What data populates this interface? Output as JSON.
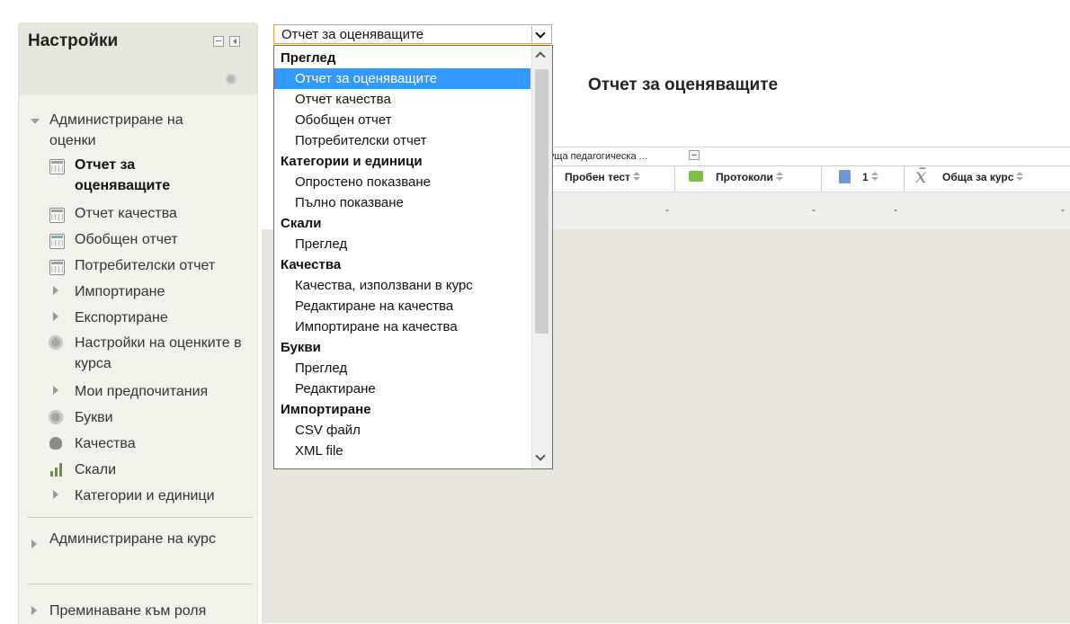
{
  "sidebar": {
    "title": "Настройки",
    "tree": {
      "grade_admin": "Администриране на оценки",
      "items": [
        {
          "label": "Отчет за оценяващите",
          "icon": "report-icon",
          "current": true
        },
        {
          "label": "Отчет качества",
          "icon": "report-icon"
        },
        {
          "label": "Обобщен отчет",
          "icon": "report-icon"
        },
        {
          "label": "Потребителски отчет",
          "icon": "report-icon"
        },
        {
          "label": "Импортиране",
          "icon": "expand-arrow-icon"
        },
        {
          "label": "Експортиране",
          "icon": "expand-arrow-icon"
        },
        {
          "label": "Настройки на оценките в курса",
          "icon": "gear-icon"
        },
        {
          "label": "Мои предпочитания",
          "icon": "expand-arrow-icon"
        },
        {
          "label": "Букви",
          "icon": "gear-icon"
        },
        {
          "label": "Качества",
          "icon": "outcomes-icon"
        },
        {
          "label": "Скали",
          "icon": "scales-icon"
        },
        {
          "label": "Категории и единици",
          "icon": "expand-arrow-icon"
        }
      ],
      "course_admin": "Администриране на курс",
      "switch_role": "Преминаване към роля"
    }
  },
  "report_select": {
    "value": "Отчет за оценяващите",
    "options": [
      {
        "type": "group",
        "label": "Преглед"
      },
      {
        "type": "item",
        "label": "Отчет за оценяващите",
        "selected": true
      },
      {
        "type": "item",
        "label": "Отчет качества"
      },
      {
        "type": "item",
        "label": "Обобщен отчет"
      },
      {
        "type": "item",
        "label": "Потребителски отчет"
      },
      {
        "type": "group",
        "label": "Категории и единици"
      },
      {
        "type": "item",
        "label": "Опростено показване"
      },
      {
        "type": "item",
        "label": "Пълно показване"
      },
      {
        "type": "group",
        "label": "Скали"
      },
      {
        "type": "item",
        "label": "Преглед"
      },
      {
        "type": "group",
        "label": "Качества"
      },
      {
        "type": "item",
        "label": "Качества, използвани в курс"
      },
      {
        "type": "item",
        "label": "Редактиране на качества"
      },
      {
        "type": "item",
        "label": "Импортиране на качества"
      },
      {
        "type": "group",
        "label": "Букви"
      },
      {
        "type": "item",
        "label": "Преглед"
      },
      {
        "type": "item",
        "label": "Редактиране"
      },
      {
        "type": "group",
        "label": "Импортиране"
      },
      {
        "type": "item",
        "label": "CSV файл"
      },
      {
        "type": "item",
        "label": "XML file"
      }
    ]
  },
  "page_title": "Отчет за оценяващите",
  "grader_table": {
    "category": "куща педагогическа ...",
    "columns": [
      {
        "label": "Пробен тест",
        "icon": "quiz-icon"
      },
      {
        "label": "Протоколи",
        "icon": "forum-icon"
      },
      {
        "label": "1",
        "icon": "assignment-icon"
      },
      {
        "label": "Обща за курс",
        "icon": "sigma-icon"
      }
    ],
    "row": [
      "-",
      "-",
      "-",
      "-"
    ]
  },
  "colors": {
    "highlight": "#3399ff",
    "select_border": "#e4a33a",
    "background": "#e7e5dd"
  }
}
